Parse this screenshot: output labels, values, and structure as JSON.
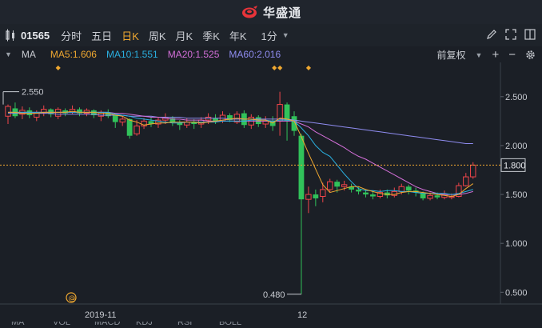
{
  "app": {
    "title": "华盛通"
  },
  "toolbar": {
    "code": "01565",
    "periods": [
      "分时",
      "五日",
      "日K",
      "周K",
      "月K",
      "季K",
      "年K"
    ],
    "active_period": "日K",
    "interval": "1分"
  },
  "indicators": {
    "name": "MA",
    "ma5": "MA5:1.606",
    "ma10": "MA10:1.551",
    "ma20": "MA20:1.525",
    "ma60": "MA60:2.016",
    "ma5_color": "#f0a830",
    "ma10_color": "#2ab0e0",
    "ma20_color": "#d36fd8",
    "ma60_color": "#8f8cf0",
    "adjust": "前复权"
  },
  "colors": {
    "up": "#f0454a",
    "down": "#31c25a",
    "bg": "#1b1f26"
  },
  "chart_data": {
    "type": "candlestick",
    "y_ticks": [
      "2.500",
      "2.000",
      "1.500",
      "1.000",
      "0.500"
    ],
    "y_tick_values": [
      2.5,
      2.0,
      1.5,
      1.0,
      0.5
    ],
    "ylim": [
      0.38,
      2.85
    ],
    "x_labels": [
      "2019-11",
      "12"
    ],
    "last_price_label": "1.800",
    "last_price": 1.8,
    "high_marker": "2.550",
    "high_value": 2.55,
    "low_marker": "0.480",
    "low_value": 0.48,
    "candles": [
      [
        2.3,
        2.4,
        2.42,
        2.22
      ],
      [
        2.38,
        2.3,
        2.44,
        2.28
      ],
      [
        2.32,
        2.36,
        2.4,
        2.27
      ],
      [
        2.36,
        2.31,
        2.39,
        2.28
      ],
      [
        2.29,
        2.33,
        2.36,
        2.25
      ],
      [
        2.33,
        2.37,
        2.41,
        2.3
      ],
      [
        2.37,
        2.32,
        2.38,
        2.29
      ],
      [
        2.3,
        2.37,
        2.39,
        2.27
      ],
      [
        2.36,
        2.33,
        2.38,
        2.3
      ],
      [
        2.34,
        2.37,
        2.41,
        2.32
      ],
      [
        2.37,
        2.33,
        2.39,
        2.3
      ],
      [
        2.33,
        2.36,
        2.38,
        2.3
      ],
      [
        2.36,
        2.31,
        2.37,
        2.28
      ],
      [
        2.3,
        2.34,
        2.36,
        2.25
      ],
      [
        2.34,
        2.3,
        2.37,
        2.28
      ],
      [
        2.31,
        2.24,
        2.32,
        2.18
      ],
      [
        2.24,
        2.27,
        2.3,
        2.2
      ],
      [
        2.27,
        2.1,
        2.28,
        2.07
      ],
      [
        2.12,
        2.2,
        2.26,
        2.1
      ],
      [
        2.2,
        2.25,
        2.28,
        2.17
      ],
      [
        2.25,
        2.22,
        2.29,
        2.19
      ],
      [
        2.22,
        2.26,
        2.29,
        2.18
      ],
      [
        2.26,
        2.28,
        2.33,
        2.22
      ],
      [
        2.28,
        2.24,
        2.3,
        2.2
      ],
      [
        2.23,
        2.21,
        2.26,
        2.16
      ],
      [
        2.21,
        2.24,
        2.28,
        2.18
      ],
      [
        2.24,
        2.22,
        2.27,
        2.17
      ],
      [
        2.22,
        2.26,
        2.29,
        2.18
      ],
      [
        2.26,
        2.29,
        2.33,
        2.22
      ],
      [
        2.28,
        2.25,
        2.32,
        2.22
      ],
      [
        2.25,
        2.31,
        2.35,
        2.23
      ],
      [
        2.31,
        2.26,
        2.33,
        2.24
      ],
      [
        2.24,
        2.32,
        2.35,
        2.22
      ],
      [
        2.33,
        2.21,
        2.36,
        2.18
      ],
      [
        2.21,
        2.29,
        2.32,
        2.17
      ],
      [
        2.29,
        2.22,
        2.31,
        2.19
      ],
      [
        2.22,
        2.25,
        2.3,
        2.18
      ],
      [
        2.25,
        2.2,
        2.3,
        2.15
      ],
      [
        2.25,
        2.42,
        2.55,
        2.1
      ],
      [
        2.42,
        2.25,
        2.44,
        2.05
      ],
      [
        2.3,
        2.15,
        2.35,
        2.1
      ],
      [
        2.1,
        1.45,
        2.12,
        0.48
      ],
      [
        1.45,
        1.5,
        1.58,
        1.31
      ],
      [
        1.5,
        1.46,
        1.55,
        1.38
      ],
      [
        1.48,
        1.55,
        1.62,
        1.42
      ],
      [
        1.55,
        1.63,
        1.66,
        1.52
      ],
      [
        1.63,
        1.58,
        1.65,
        1.52
      ],
      [
        1.58,
        1.6,
        1.64,
        1.54
      ],
      [
        1.58,
        1.55,
        1.61,
        1.52
      ],
      [
        1.55,
        1.53,
        1.58,
        1.5
      ],
      [
        1.52,
        1.5,
        1.55,
        1.47
      ],
      [
        1.5,
        1.48,
        1.54,
        1.45
      ],
      [
        1.48,
        1.52,
        1.55,
        1.46
      ],
      [
        1.52,
        1.49,
        1.55,
        1.46
      ],
      [
        1.49,
        1.53,
        1.57,
        1.47
      ],
      [
        1.53,
        1.58,
        1.61,
        1.5
      ],
      [
        1.58,
        1.54,
        1.6,
        1.5
      ],
      [
        1.54,
        1.52,
        1.57,
        1.48
      ],
      [
        1.51,
        1.46,
        1.53,
        1.44
      ],
      [
        1.46,
        1.49,
        1.52,
        1.44
      ],
      [
        1.49,
        1.47,
        1.52,
        1.45
      ],
      [
        1.47,
        1.5,
        1.54,
        1.45
      ],
      [
        1.47,
        1.48,
        1.51,
        1.45
      ],
      [
        1.48,
        1.59,
        1.62,
        1.47
      ],
      [
        1.59,
        1.68,
        1.72,
        1.58
      ],
      [
        1.68,
        1.8,
        1.83,
        1.66
      ]
    ],
    "ma_lines": {
      "ma5": [
        2.34,
        2.34,
        2.33,
        2.33,
        2.33,
        2.34,
        2.34,
        2.34,
        2.34,
        2.35,
        2.34,
        2.34,
        2.34,
        2.33,
        2.33,
        2.31,
        2.3,
        2.26,
        2.24,
        2.21,
        2.22,
        2.23,
        2.23,
        2.24,
        2.24,
        2.24,
        2.24,
        2.23,
        2.24,
        2.25,
        2.26,
        2.27,
        2.28,
        2.27,
        2.27,
        2.26,
        2.26,
        2.23,
        2.28,
        2.27,
        2.25,
        2.09,
        1.92,
        1.76,
        1.6,
        1.52,
        1.54,
        1.56,
        1.58,
        1.58,
        1.55,
        1.53,
        1.51,
        1.5,
        1.5,
        1.52,
        1.53,
        1.53,
        1.52,
        1.51,
        1.5,
        1.49,
        1.48,
        1.5,
        1.56,
        1.61
      ],
      "ma10": [
        2.34,
        2.34,
        2.34,
        2.34,
        2.34,
        2.34,
        2.34,
        2.34,
        2.34,
        2.34,
        2.34,
        2.34,
        2.34,
        2.34,
        2.34,
        2.32,
        2.31,
        2.3,
        2.28,
        2.27,
        2.26,
        2.25,
        2.24,
        2.23,
        2.23,
        2.24,
        2.24,
        2.24,
        2.24,
        2.24,
        2.25,
        2.25,
        2.25,
        2.25,
        2.26,
        2.26,
        2.26,
        2.25,
        2.26,
        2.26,
        2.25,
        2.18,
        2.1,
        2.0,
        1.93,
        1.89,
        1.8,
        1.71,
        1.63,
        1.56,
        1.54,
        1.54,
        1.53,
        1.54,
        1.54,
        1.53,
        1.53,
        1.52,
        1.51,
        1.51,
        1.51,
        1.51,
        1.5,
        1.51,
        1.53,
        1.55
      ],
      "ma20": [
        2.34,
        2.34,
        2.34,
        2.34,
        2.34,
        2.34,
        2.34,
        2.34,
        2.34,
        2.34,
        2.34,
        2.34,
        2.34,
        2.34,
        2.34,
        2.33,
        2.33,
        2.32,
        2.31,
        2.3,
        2.29,
        2.29,
        2.28,
        2.27,
        2.27,
        2.26,
        2.26,
        2.26,
        2.25,
        2.25,
        2.25,
        2.25,
        2.25,
        2.25,
        2.25,
        2.25,
        2.25,
        2.25,
        2.25,
        2.25,
        2.25,
        2.22,
        2.19,
        2.14,
        2.1,
        2.06,
        2.02,
        1.98,
        1.93,
        1.89,
        1.86,
        1.82,
        1.78,
        1.74,
        1.7,
        1.66,
        1.62,
        1.58,
        1.55,
        1.53,
        1.51,
        1.5,
        1.5,
        1.5,
        1.51,
        1.53
      ],
      "ma60": [
        2.33,
        2.33,
        2.33,
        2.33,
        2.33,
        2.33,
        2.33,
        2.32,
        2.32,
        2.32,
        2.32,
        2.32,
        2.32,
        2.31,
        2.31,
        2.31,
        2.31,
        2.3,
        2.3,
        2.3,
        2.3,
        2.29,
        2.29,
        2.29,
        2.29,
        2.28,
        2.28,
        2.28,
        2.28,
        2.28,
        2.28,
        2.27,
        2.27,
        2.27,
        2.27,
        2.27,
        2.27,
        2.27,
        2.27,
        2.27,
        2.26,
        2.25,
        2.24,
        2.23,
        2.22,
        2.21,
        2.2,
        2.19,
        2.18,
        2.17,
        2.16,
        2.15,
        2.14,
        2.13,
        2.12,
        2.11,
        2.1,
        2.09,
        2.08,
        2.07,
        2.06,
        2.05,
        2.04,
        2.03,
        2.02,
        2.02
      ]
    },
    "markers": [
      "◆",
      "◆",
      "◆",
      "◆"
    ]
  },
  "bottom": {
    "tabs": [
      "MA",
      "VOL",
      "MACD",
      "KDJ",
      "RSI",
      "BOLL"
    ]
  }
}
